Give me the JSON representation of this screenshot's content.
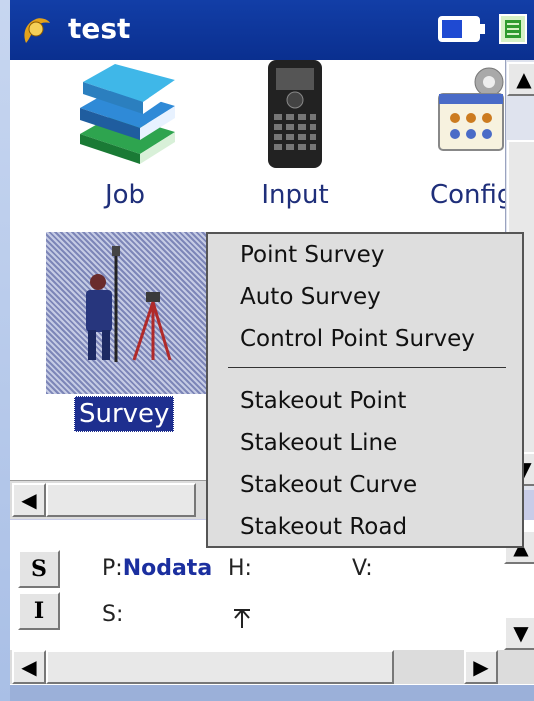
{
  "window": {
    "title": "test"
  },
  "launcher": {
    "apps": [
      {
        "label": "Job",
        "icon": "books-icon"
      },
      {
        "label": "Input",
        "icon": "handheld-device-icon"
      },
      {
        "label": "Config",
        "icon": "settings-gear-icon"
      },
      {
        "label": "Survey",
        "icon": "surveyor-tripod-icon",
        "selected": true
      }
    ]
  },
  "context_menu": {
    "group1": [
      "Point Survey",
      "Auto Survey",
      "Control Point Survey"
    ],
    "group2": [
      "Stakeout Point",
      "Stakeout Line",
      "Stakeout Curve",
      "Stakeout Road"
    ]
  },
  "status_panel": {
    "tabs": [
      "S",
      "I"
    ],
    "point_label": "P:",
    "point_value": "Nodata",
    "h_label": "H:",
    "v_label": "V:",
    "s_label": "S:"
  },
  "colors": {
    "titlebar": "#123ea7",
    "selection": "#1e2f8f",
    "menu_background": "#dedede"
  }
}
